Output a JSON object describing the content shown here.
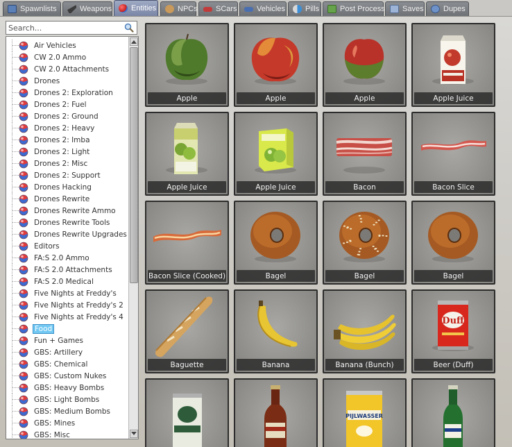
{
  "tabs": [
    {
      "label": "Spawnlists",
      "icon": "spawnlist-icon",
      "active": false
    },
    {
      "label": "Weapons",
      "icon": "weapon-icon",
      "active": false
    },
    {
      "label": "Entities",
      "icon": "entities-icon",
      "active": true
    },
    {
      "label": "NPCs",
      "icon": "npc-icon",
      "active": false
    },
    {
      "label": "SCars",
      "icon": "scar-icon",
      "active": false
    },
    {
      "label": "Vehicles",
      "icon": "vehicle-icon",
      "active": false
    },
    {
      "label": "Pills",
      "icon": "pill-icon",
      "active": false
    },
    {
      "label": "Post Process",
      "icon": "post-process-icon",
      "active": false
    },
    {
      "label": "Saves",
      "icon": "saves-icon",
      "active": false
    },
    {
      "label": "Dupes",
      "icon": "dupes-icon",
      "active": false
    }
  ],
  "search": {
    "placeholder": "Search..."
  },
  "categories": [
    {
      "label": "Air Vehicles"
    },
    {
      "label": "CW 2.0 Ammo"
    },
    {
      "label": "CW 2.0 Attachments"
    },
    {
      "label": "Drones"
    },
    {
      "label": "Drones 2: Exploration"
    },
    {
      "label": "Drones 2: Fuel"
    },
    {
      "label": "Drones 2: Ground"
    },
    {
      "label": "Drones 2: Heavy"
    },
    {
      "label": "Drones 2: Imba"
    },
    {
      "label": "Drones 2: Light"
    },
    {
      "label": "Drones 2: Misc"
    },
    {
      "label": "Drones 2: Support"
    },
    {
      "label": "Drones Hacking"
    },
    {
      "label": "Drones Rewrite"
    },
    {
      "label": "Drones Rewrite Ammo"
    },
    {
      "label": "Drones Rewrite Tools"
    },
    {
      "label": "Drones Rewrite Upgrades"
    },
    {
      "label": "Editors"
    },
    {
      "label": "FA:S 2.0 Ammo"
    },
    {
      "label": "FA:S 2.0 Attachments"
    },
    {
      "label": "FA:S 2.0 Medical"
    },
    {
      "label": "Five Nights at Freddy's"
    },
    {
      "label": "Five Nights at Freddy's 2"
    },
    {
      "label": "Five Nights at Freddy's 4"
    },
    {
      "label": "Food",
      "selected": true
    },
    {
      "label": "Fun + Games"
    },
    {
      "label": "GBS: Artillery"
    },
    {
      "label": "GBS: Chemical"
    },
    {
      "label": "GBS: Custom Nukes"
    },
    {
      "label": "GBS: Heavy Bombs"
    },
    {
      "label": "GBS: Light Bombs"
    },
    {
      "label": "GBS: Medium Bombs"
    },
    {
      "label": "GBS: Mines"
    },
    {
      "label": "GBS: Misc"
    }
  ],
  "items": [
    {
      "label": "Apple",
      "icon": "green-apple-icon"
    },
    {
      "label": "Apple",
      "icon": "red-apple-icon"
    },
    {
      "label": "Apple",
      "icon": "red-green-apple-icon"
    },
    {
      "label": "Apple Juice",
      "icon": "red-apple-juice-carton-icon"
    },
    {
      "label": "Apple Juice",
      "icon": "green-apple-juice-carton-icon"
    },
    {
      "label": "Apple Juice",
      "icon": "juice-box-icon"
    },
    {
      "label": "Bacon",
      "icon": "bacon-icon"
    },
    {
      "label": "Bacon Slice",
      "icon": "bacon-slice-icon"
    },
    {
      "label": "Bacon Slice (Cooked)",
      "icon": "cooked-bacon-icon"
    },
    {
      "label": "Bagel",
      "icon": "bagel-icon"
    },
    {
      "label": "Bagel",
      "icon": "sesame-bagel-icon"
    },
    {
      "label": "Bagel",
      "icon": "bagel-icon"
    },
    {
      "label": "Baguette",
      "icon": "baguette-icon"
    },
    {
      "label": "Banana",
      "icon": "banana-icon"
    },
    {
      "label": "Banana (Bunch)",
      "icon": "banana-bunch-icon"
    },
    {
      "label": "Beer (Duff)",
      "icon": "duff-can-icon"
    },
    {
      "label": "",
      "icon": "beer-can-icon"
    },
    {
      "label": "",
      "icon": "beer-bottle-icon"
    },
    {
      "label": "",
      "icon": "pijlwasser-can-icon"
    },
    {
      "label": "",
      "icon": "green-beer-bottle-icon"
    }
  ]
}
